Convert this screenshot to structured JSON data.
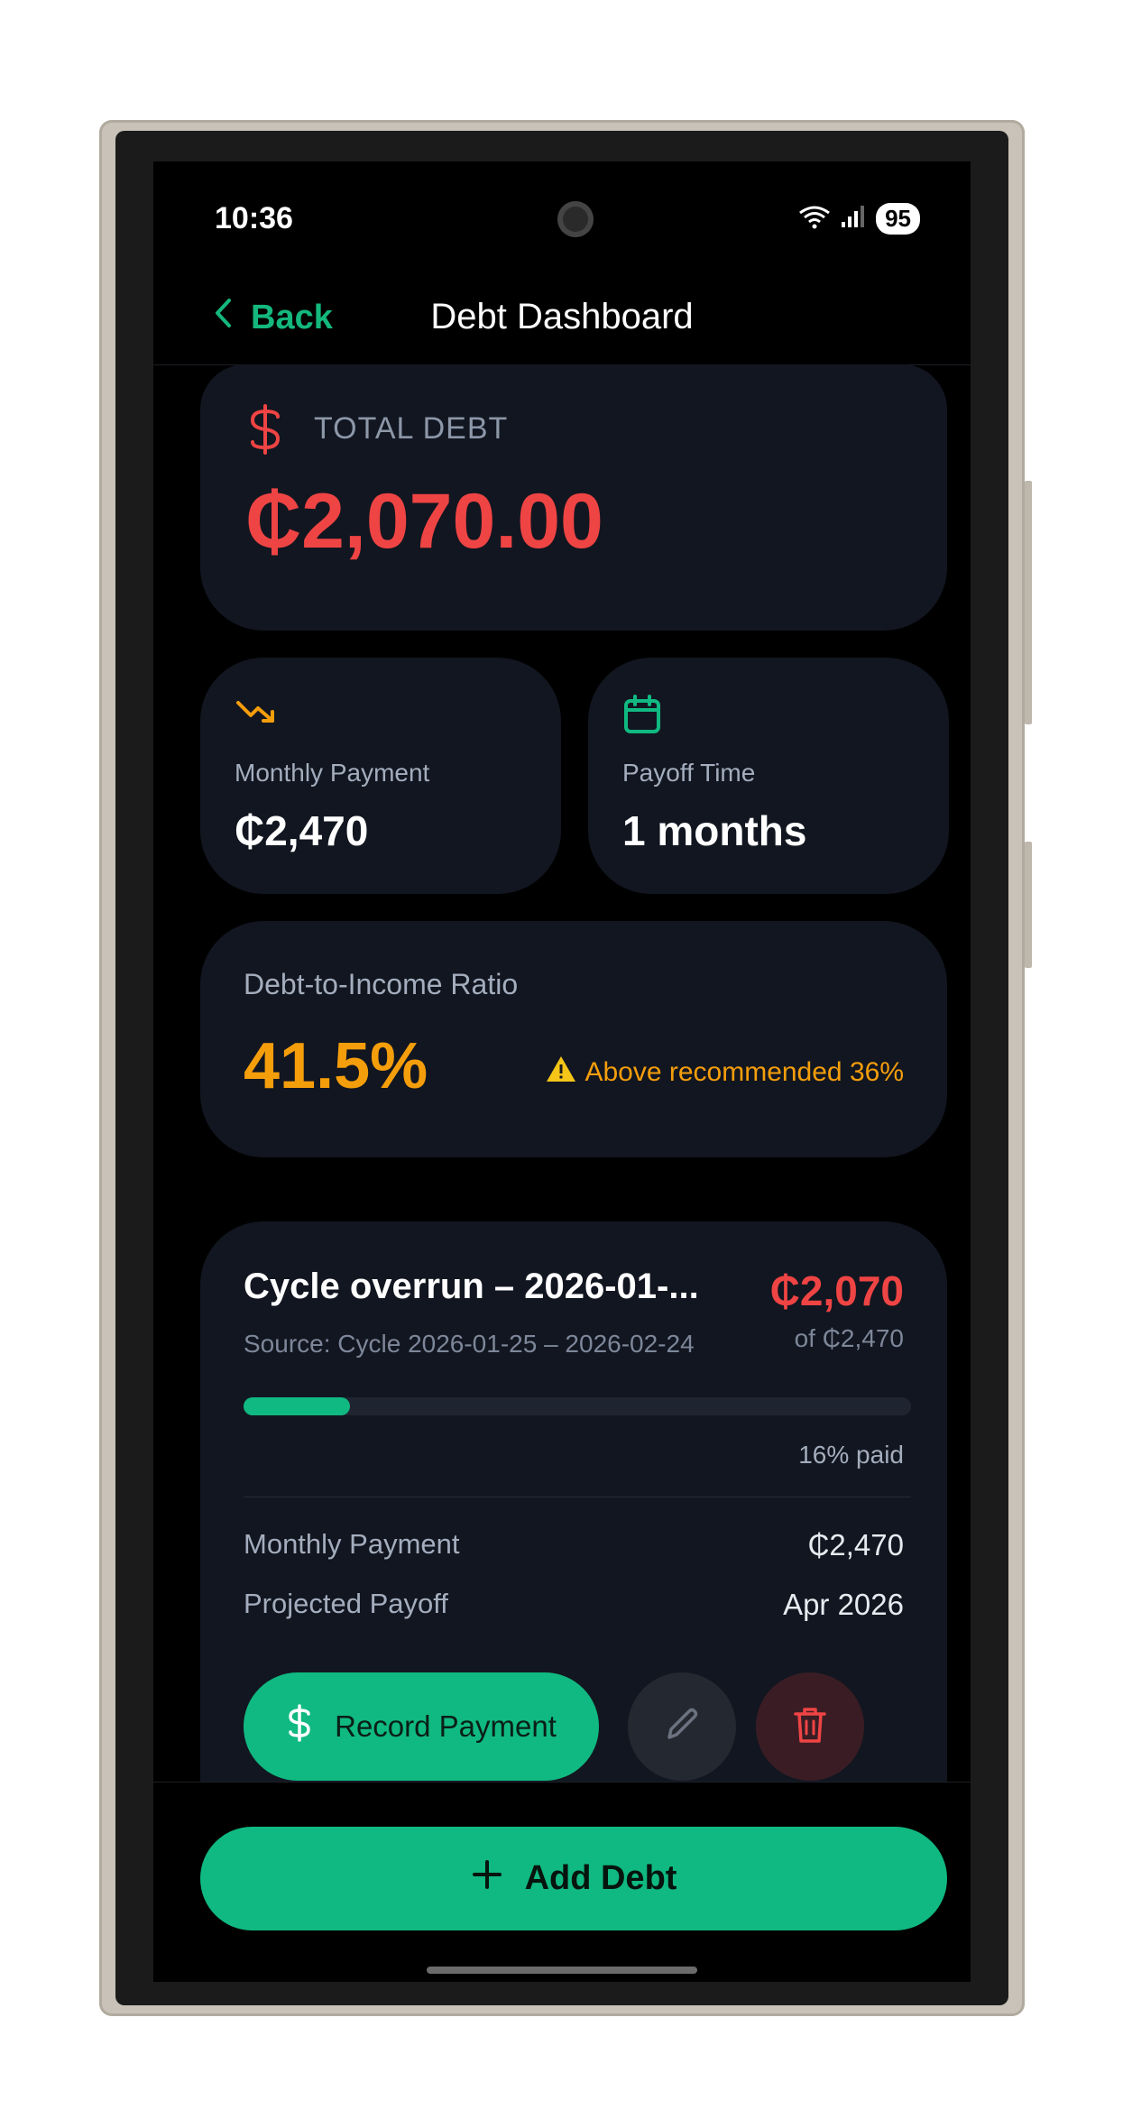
{
  "status_bar": {
    "time": "10:36",
    "battery": "95"
  },
  "nav": {
    "back_label": "Back",
    "title": "Debt Dashboard"
  },
  "total_debt": {
    "label": "TOTAL DEBT",
    "value": "₵2,070.00"
  },
  "monthly_payment": {
    "label": "Monthly Payment",
    "value": "₵2,470"
  },
  "payoff_time": {
    "label": "Payoff Time",
    "value": "1 months"
  },
  "dti": {
    "label": "Debt-to-Income Ratio",
    "value": "41.5%",
    "warning": "Above recommended 36%"
  },
  "debt_item": {
    "title": "Cycle overrun – 2026-01-...",
    "source": "Source: Cycle 2026-01-25 – 2026-02-24",
    "amount": "₵2,070",
    "of_total": "of ₵2,470",
    "progress_percent": 16,
    "progress_label": "16% paid",
    "rows": [
      {
        "label": "Monthly Payment",
        "value": "₵2,470"
      },
      {
        "label": "Projected Payoff",
        "value": "Apr 2026"
      }
    ],
    "record_payment_label": "Record Payment"
  },
  "add_debt_label": "Add Debt",
  "colors": {
    "accent": "#10b981",
    "danger": "#ef4444",
    "warning": "#f59e0b",
    "card": "#121620"
  }
}
